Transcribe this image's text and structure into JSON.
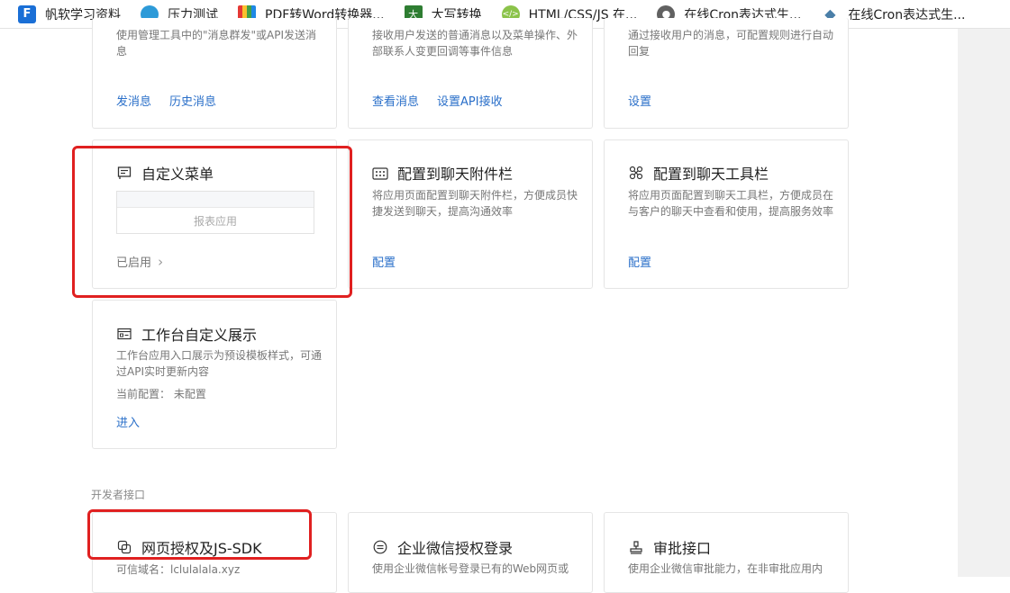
{
  "bookmarks": [
    {
      "label": "帆软学习资料",
      "icon": "fanruan-icon"
    },
    {
      "label": "压力测试",
      "icon": "pressure-test-icon"
    },
    {
      "label": "PDF转Word转换器...",
      "icon": "pdf-converter-icon"
    },
    {
      "label": "大写转换",
      "icon": "uppercase-convert-icon"
    },
    {
      "label": "HTML/CSS/JS 在...",
      "icon": "html-tool-icon"
    },
    {
      "label": "在线Cron表达式生...",
      "icon": "globe-icon"
    },
    {
      "label": "在线Cron表达式生...",
      "icon": "bird-icon"
    }
  ],
  "cards_top": [
    {
      "desc": "使用管理工具中的\"消息群发\"或API发送消息",
      "links": [
        "发消息",
        "历史消息"
      ]
    },
    {
      "desc": "接收用户发送的普通消息以及菜单操作、外部联系人变更回调等事件信息",
      "links": [
        "查看消息",
        "设置API接收"
      ]
    },
    {
      "desc": "通过接收用户的消息，可配置规则进行自动回复",
      "links": [
        "设置"
      ]
    }
  ],
  "custom_menu": {
    "title": "自定义菜单",
    "menu_item": "报表应用",
    "status": "已启用",
    "status_chevron": "›"
  },
  "chat_attach": {
    "title": "配置到聊天附件栏",
    "desc": "将应用页面配置到聊天附件栏，方便成员快捷发送到聊天，提高沟通效率",
    "link": "配置"
  },
  "chat_toolbar": {
    "title": "配置到聊天工具栏",
    "desc": "将应用页面配置到聊天工具栏，方便成员在与客户的聊天中查看和使用，提高服务效率",
    "link": "配置"
  },
  "workbench": {
    "title": "工作台自定义展示",
    "desc": "工作台应用入口展示为预设模板样式，可通过API实时更新内容",
    "config": "当前配置：  未配置",
    "link": "进入"
  },
  "dev_section": {
    "label": "开发者接口"
  },
  "web_auth": {
    "title": "网页授权及JS-SDK",
    "domain": "可信域名：lclulalala.xyz"
  },
  "wecom_login": {
    "title": "企业微信授权登录",
    "desc": "使用企业微信帐号登录已有的Web网页或"
  },
  "approval": {
    "title": "审批接口",
    "desc": "使用企业微信审批能力，在非审批应用内"
  },
  "colors": {
    "link": "#2a6fc9",
    "highlight": "#e02020"
  }
}
